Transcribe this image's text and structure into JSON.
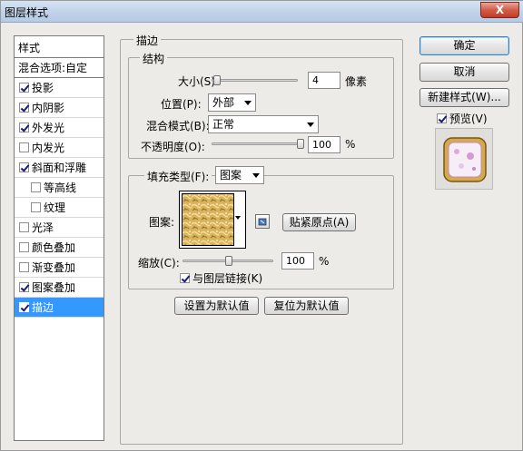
{
  "window": {
    "title": "图层样式",
    "close_glyph": "X"
  },
  "left_panel": {
    "header": "样式",
    "blend_options": "混合选项:自定",
    "items": [
      {
        "label": "投影",
        "checked": true,
        "sub": false,
        "selected": false
      },
      {
        "label": "内阴影",
        "checked": true,
        "sub": false,
        "selected": false
      },
      {
        "label": "外发光",
        "checked": true,
        "sub": false,
        "selected": false
      },
      {
        "label": "内发光",
        "checked": false,
        "sub": false,
        "selected": false
      },
      {
        "label": "斜面和浮雕",
        "checked": true,
        "sub": false,
        "selected": false
      },
      {
        "label": "等高线",
        "checked": false,
        "sub": true,
        "selected": false
      },
      {
        "label": "纹理",
        "checked": false,
        "sub": true,
        "selected": false
      },
      {
        "label": "光泽",
        "checked": false,
        "sub": false,
        "selected": false
      },
      {
        "label": "颜色叠加",
        "checked": false,
        "sub": false,
        "selected": false
      },
      {
        "label": "渐变叠加",
        "checked": false,
        "sub": false,
        "selected": false
      },
      {
        "label": "图案叠加",
        "checked": true,
        "sub": false,
        "selected": false
      },
      {
        "label": "描边",
        "checked": true,
        "sub": false,
        "selected": true
      }
    ]
  },
  "stroke": {
    "group_title": "描边",
    "structure_title": "结构",
    "size_label": "大小(S):",
    "size_value": "4",
    "size_unit": "像素",
    "size_slider_level": 0.02,
    "position_label": "位置(P):",
    "position_value": "外部",
    "blend_label": "混合模式(B):",
    "blend_value": "正常",
    "opacity_label": "不透明度(O):",
    "opacity_value": "100",
    "opacity_unit": "%",
    "opacity_slider_level": 1.0,
    "fill_type_label": "填充类型(F):",
    "fill_type_value": "图案",
    "pattern_label": "图案:",
    "snap_button": "贴紧原点(A)",
    "scale_label": "缩放(C):",
    "scale_value": "100",
    "scale_unit": "%",
    "scale_slider_level": 0.5,
    "link_label": "与图层链接(K)",
    "link_checked": true,
    "make_default": "设置为默认值",
    "reset_default": "复位为默认值"
  },
  "right_buttons": {
    "ok": "确定",
    "cancel": "取消",
    "new_style": "新建样式(W)...",
    "preview_label": "预览(V)",
    "preview_checked": true
  },
  "colors": {
    "selection": "#3399ff",
    "pattern_gold": "#d9b45f"
  }
}
